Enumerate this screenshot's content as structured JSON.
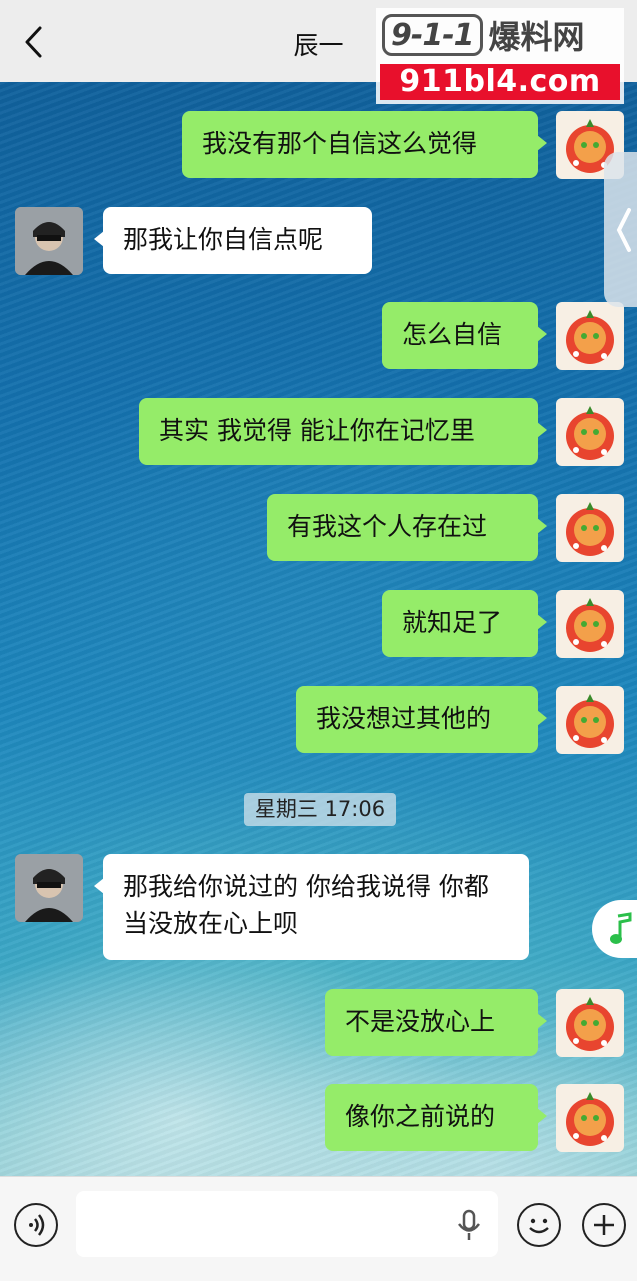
{
  "header": {
    "title": "辰一"
  },
  "watermark": {
    "badge": "9-1-1",
    "name": "爆料网",
    "url": "911bl4.com"
  },
  "messages": [
    {
      "side": "mine",
      "text": "我没有那个自信这么觉得"
    },
    {
      "side": "theirs",
      "text": "那我让你自信点呢"
    },
    {
      "side": "mine",
      "text": "怎么自信"
    },
    {
      "side": "mine",
      "text": "其实 我觉得 能让你在记忆里"
    },
    {
      "side": "mine",
      "text": "有我这个人存在过"
    },
    {
      "side": "mine",
      "text": "就知足了"
    },
    {
      "side": "mine",
      "text": "我没想过其他的"
    },
    {
      "side": "theirs",
      "text": "那我给你说过的 你给我说得 你都当没放在心上呗"
    },
    {
      "side": "mine",
      "text": "不是没放心上"
    },
    {
      "side": "mine",
      "text": "像你之前说的"
    }
  ],
  "timestamp": "星期三 17:06",
  "input": {
    "value": "",
    "placeholder": ""
  },
  "icons": {
    "back": "chevron-left-icon",
    "voice": "voice-icon",
    "mic": "mic-icon",
    "emoji": "emoji-icon",
    "add": "plus-icon",
    "music": "music-note-icon",
    "side": "side-tab-icon"
  },
  "colors": {
    "mine_bubble": "#95ec69",
    "theirs_bubble": "#ffffff",
    "header_bg": "#ededed",
    "watermark_red": "#e8102c"
  }
}
